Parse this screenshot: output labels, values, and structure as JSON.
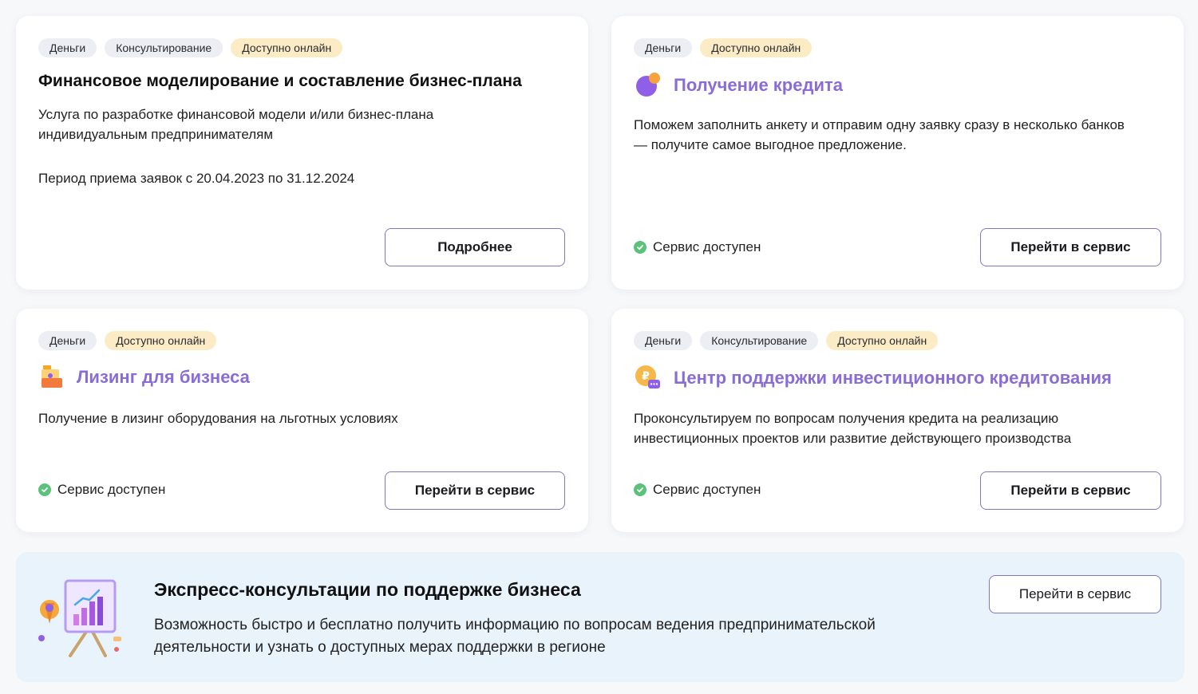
{
  "cards": [
    {
      "tags": [
        "Деньги",
        "Консультирование",
        "Доступно онлайн"
      ],
      "title": "Финансовое моделирование и составление бизнес-плана",
      "description_lines": [
        "Услуга по разработке финансовой модели и/или бизнес-плана",
        "индивидуальным предпринимателям"
      ],
      "period": "Период приема заявок с 20.04.2023 по 31.12.2024",
      "button": "Подробнее"
    },
    {
      "tags": [
        "Деньги",
        "Доступно онлайн"
      ],
      "icon": "credit-icon",
      "title": "Получение кредита",
      "description_lines": [
        "Поможем заполнить анкету и отправим одну заявку сразу в несколько банков",
        "— получите самое выгодное предложение."
      ],
      "status": "Сервис доступен",
      "button": "Перейти в сервис"
    },
    {
      "tags": [
        "Деньги",
        "Доступно онлайн"
      ],
      "icon": "leasing-icon",
      "title": "Лизинг для бизнеса",
      "description_lines": [
        "Получение в лизинг оборудования на льготных условиях"
      ],
      "status": "Сервис доступен",
      "button": "Перейти в сервис"
    },
    {
      "tags": [
        "Деньги",
        "Консультирование",
        "Доступно онлайн"
      ],
      "icon": "ruble-chat-icon",
      "title": "Центр поддержки инвестиционного кредитования",
      "description_lines": [
        "Проконсультируем по вопросам получения кредита на реализацию",
        "инвестиционных проектов или развитие действующего производства"
      ],
      "status": "Сервис доступен",
      "button": "Перейти в сервис"
    }
  ],
  "banner": {
    "icon": "presentation-board-icon",
    "title": "Экспресс-консультации по поддержке бизнеса",
    "description_lines": [
      "Возможность быстро и бесплатно получить информацию по вопросам ведения предпринимательской",
      "деятельности и узнать о доступных мерах поддержки в регионе"
    ],
    "button": "Перейти в сервис"
  },
  "colors": {
    "accent_title": "#8a6cd6",
    "tag_online_bg": "#fbecc6",
    "tag_bg": "#eceef3",
    "status_ok": "#5cc17b",
    "banner_bg": "#e8f3fc",
    "button_border": "#7f78bf"
  }
}
